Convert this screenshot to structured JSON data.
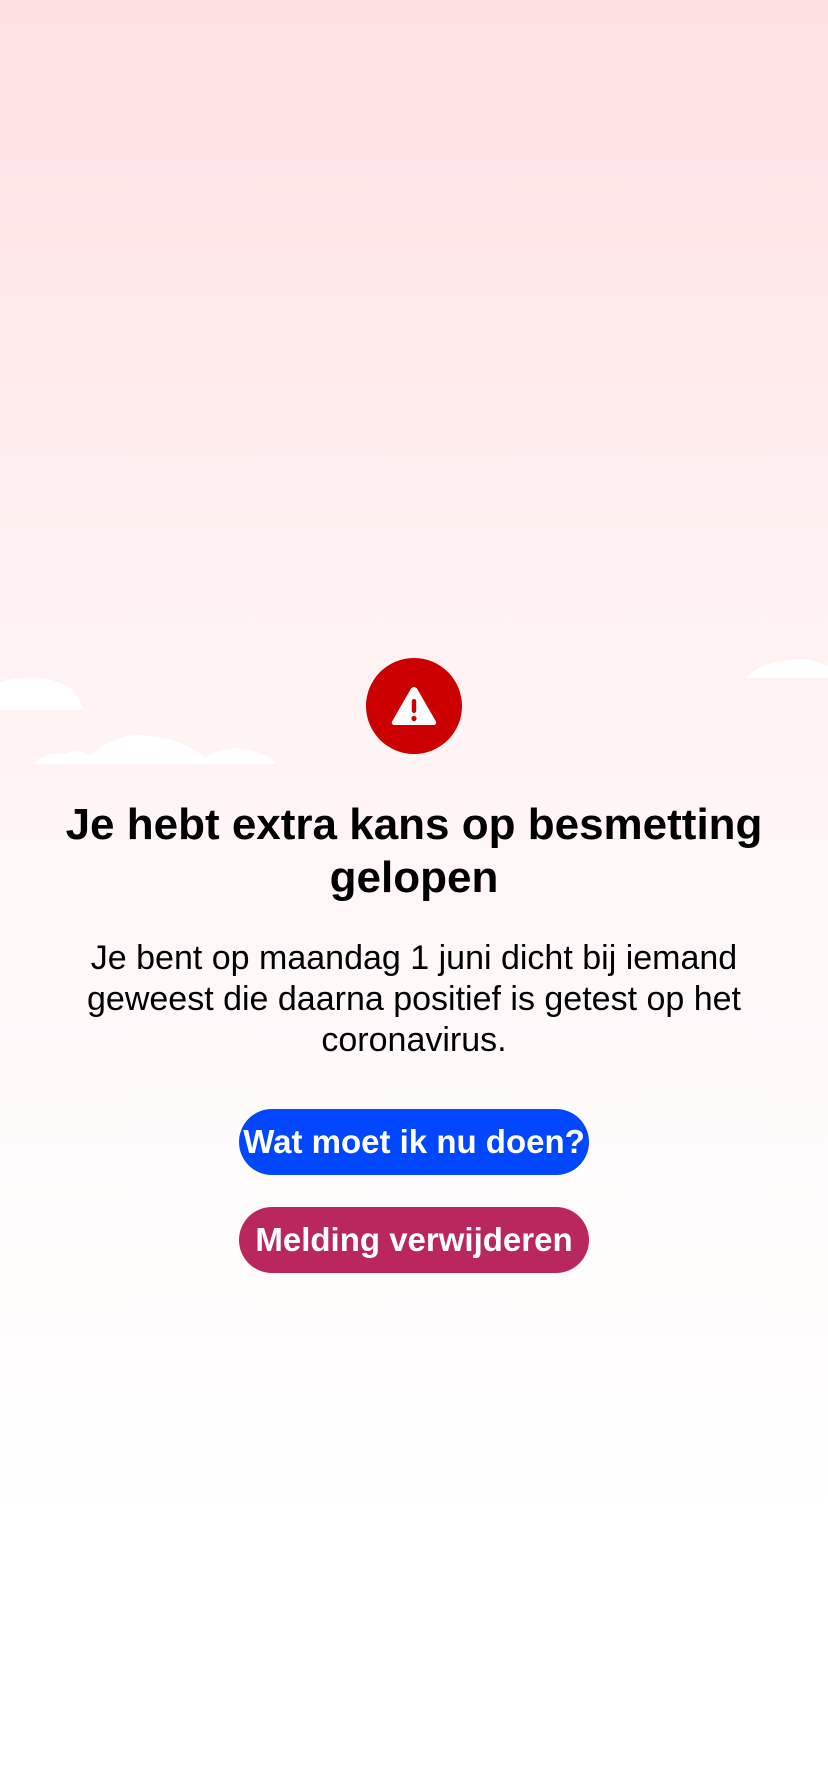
{
  "notification": {
    "icon": "warning-icon",
    "title": "Je hebt extra kans op besmetting gelopen",
    "body": "Je bent op maandag 1 juni dicht bij iemand geweest die daarna positief is getest op het coronavirus."
  },
  "actions": {
    "primary_label": "Wat moet ik nu doen?",
    "secondary_label": "Melding verwijderen"
  },
  "colors": {
    "warning": "#cc0000",
    "primary_button": "#0147ff",
    "secondary_button": "#b9275e",
    "background_top": "#ffe0e2"
  }
}
